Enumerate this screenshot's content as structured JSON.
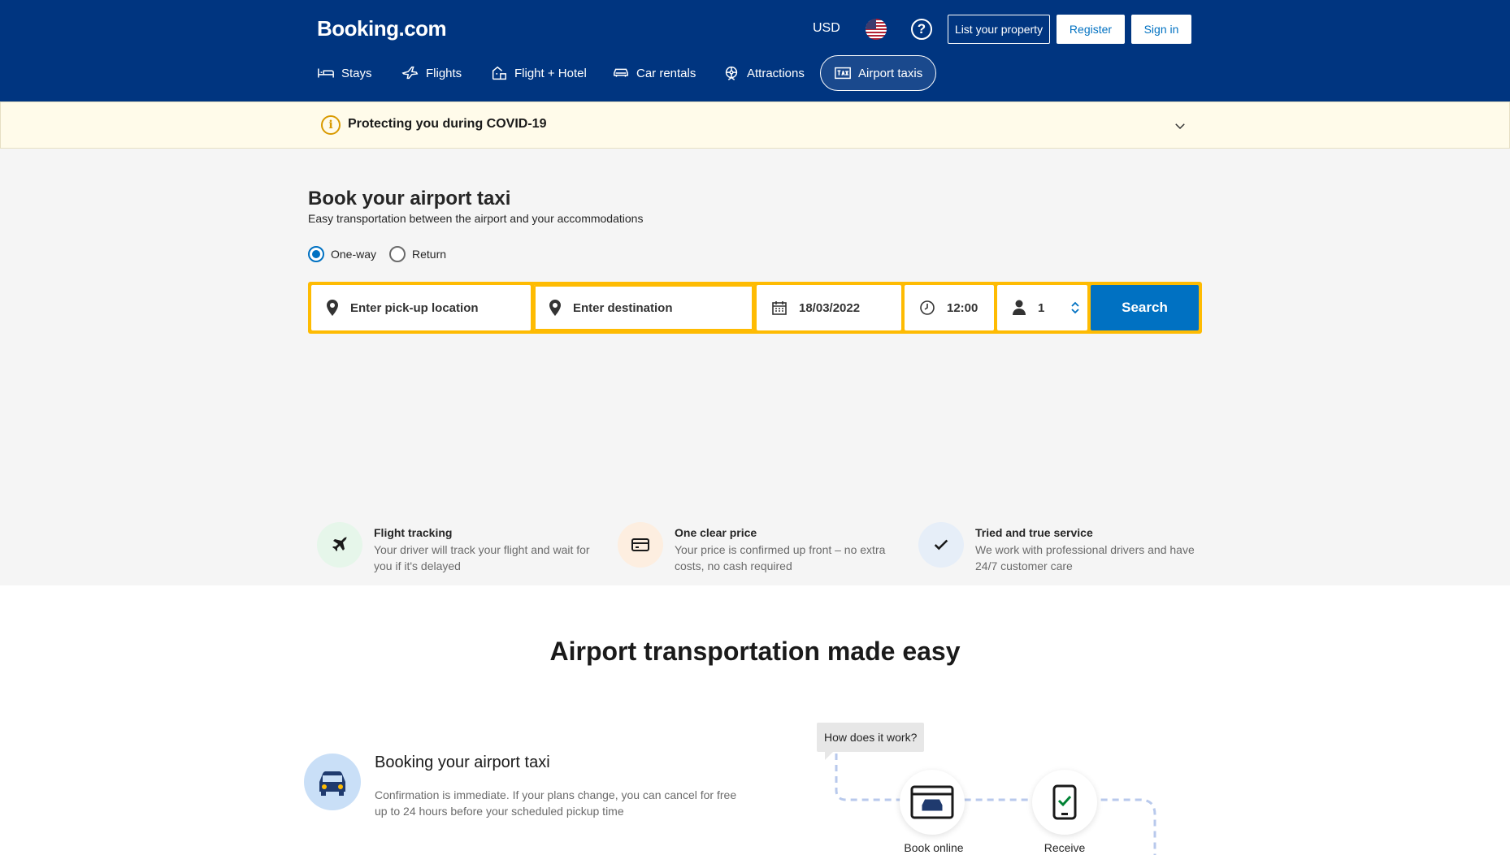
{
  "header": {
    "logo": "Booking.com",
    "currency": "USD",
    "help_symbol": "?",
    "list_property": "List your property",
    "register": "Register",
    "sign_in": "Sign in",
    "brand_color": "#003580"
  },
  "nav": {
    "items": [
      {
        "label": "Stays",
        "icon": "bed-icon"
      },
      {
        "label": "Flights",
        "icon": "plane-icon"
      },
      {
        "label": "Flight + Hotel",
        "icon": "flight-hotel-icon"
      },
      {
        "label": "Car rentals",
        "icon": "car-icon"
      },
      {
        "label": "Attractions",
        "icon": "attractions-icon"
      },
      {
        "label": "Airport taxis",
        "icon": "taxi-icon",
        "active": true
      }
    ]
  },
  "banner": {
    "icon_symbol": "i",
    "text": "Protecting you during COVID-19"
  },
  "hero": {
    "title": "Book your airport taxi",
    "subtitle": "Easy transportation between the airport and your accommodations",
    "trip_types": [
      {
        "label": "One-way",
        "selected": true
      },
      {
        "label": "Return",
        "selected": false
      }
    ],
    "search": {
      "pickup_placeholder": "Enter pick-up location",
      "destination_placeholder": "Enter destination",
      "date": "18/03/2022",
      "time": "12:00",
      "passengers": "1",
      "button": "Search",
      "accent_color": "#febb02",
      "button_color": "#0071c2"
    }
  },
  "features": [
    {
      "title": "Flight tracking",
      "desc": "Your driver will track your flight and wait for you if it's delayed",
      "icon": "plane-icon"
    },
    {
      "title": "One clear price",
      "desc": "Your price is confirmed up front – no extra costs, no cash required",
      "icon": "credit-card-icon"
    },
    {
      "title": "Tried and true service",
      "desc": "We work with professional drivers and have 24/7 customer care",
      "icon": "check-icon"
    }
  ],
  "lower": {
    "title": "Airport transportation made easy",
    "step": {
      "title": "Booking your airport taxi",
      "desc": "Confirmation is immediate. If your plans change, you can cancel for free up to 24 hours before your scheduled pickup time"
    },
    "tooltip": "How does it work?",
    "diagram": [
      {
        "label": "Book online",
        "icon": "browser-car-icon"
      },
      {
        "label": "Receive",
        "icon": "phone-check-icon"
      }
    ]
  }
}
